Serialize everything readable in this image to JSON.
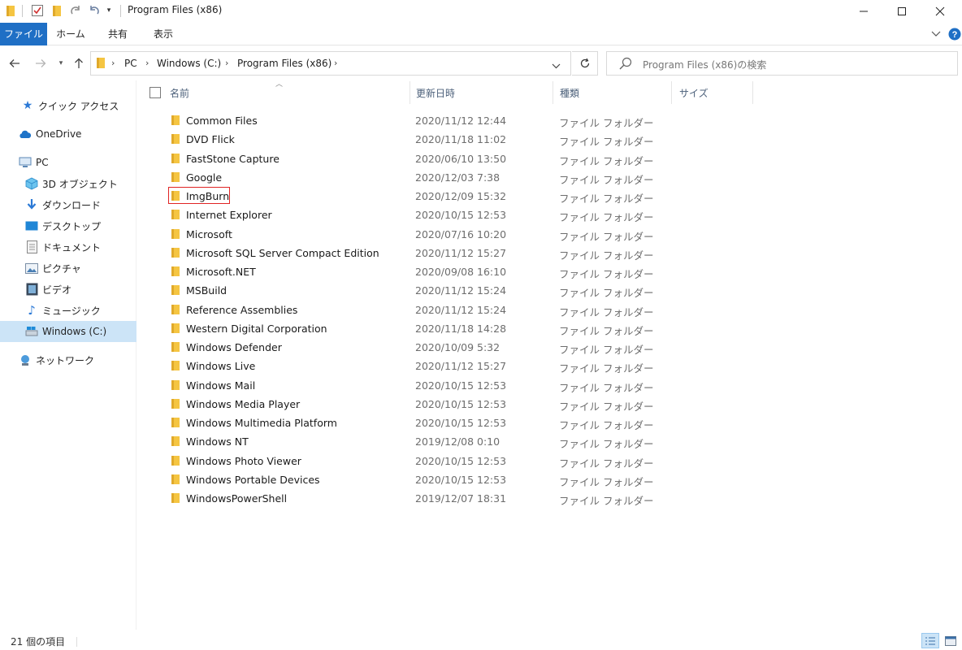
{
  "window": {
    "title": "Program Files (x86)"
  },
  "ribbon": {
    "tabs": [
      "ファイル",
      "ホーム",
      "共有",
      "表示"
    ]
  },
  "address": {
    "segments": [
      "PC",
      "Windows (C:)",
      "Program Files (x86)"
    ]
  },
  "search": {
    "placeholder": "Program Files (x86)の検索"
  },
  "nav_pane": {
    "quick_access": "クイック アクセス",
    "onedrive": "OneDrive",
    "pc": "PC",
    "items": [
      "3D オブジェクト",
      "ダウンロード",
      "デスクトップ",
      "ドキュメント",
      "ピクチャ",
      "ビデオ",
      "ミュージック",
      "Windows (C:)"
    ],
    "network": "ネットワーク",
    "selected": "Windows (C:)"
  },
  "columns": {
    "name": "名前",
    "date": "更新日時",
    "type": "種類",
    "size": "サイズ"
  },
  "files": [
    {
      "name": "Common Files",
      "date": "2020/11/12 12:44",
      "type": "ファイル フォルダー"
    },
    {
      "name": "DVD Flick",
      "date": "2020/11/18 11:02",
      "type": "ファイル フォルダー"
    },
    {
      "name": "FastStone Capture",
      "date": "2020/06/10 13:50",
      "type": "ファイル フォルダー"
    },
    {
      "name": "Google",
      "date": "2020/12/03 7:38",
      "type": "ファイル フォルダー"
    },
    {
      "name": "ImgBurn",
      "date": "2020/12/09 15:32",
      "type": "ファイル フォルダー",
      "highlighted": true
    },
    {
      "name": "Internet Explorer",
      "date": "2020/10/15 12:53",
      "type": "ファイル フォルダー"
    },
    {
      "name": "Microsoft",
      "date": "2020/07/16 10:20",
      "type": "ファイル フォルダー"
    },
    {
      "name": "Microsoft SQL Server Compact Edition",
      "date": "2020/11/12 15:27",
      "type": "ファイル フォルダー"
    },
    {
      "name": "Microsoft.NET",
      "date": "2020/09/08 16:10",
      "type": "ファイル フォルダー"
    },
    {
      "name": "MSBuild",
      "date": "2020/11/12 15:24",
      "type": "ファイル フォルダー"
    },
    {
      "name": "Reference Assemblies",
      "date": "2020/11/12 15:24",
      "type": "ファイル フォルダー"
    },
    {
      "name": "Western Digital Corporation",
      "date": "2020/11/18 14:28",
      "type": "ファイル フォルダー"
    },
    {
      "name": "Windows Defender",
      "date": "2020/10/09 5:32",
      "type": "ファイル フォルダー"
    },
    {
      "name": "Windows Live",
      "date": "2020/11/12 15:27",
      "type": "ファイル フォルダー"
    },
    {
      "name": "Windows Mail",
      "date": "2020/10/15 12:53",
      "type": "ファイル フォルダー"
    },
    {
      "name": "Windows Media Player",
      "date": "2020/10/15 12:53",
      "type": "ファイル フォルダー"
    },
    {
      "name": "Windows Multimedia Platform",
      "date": "2020/10/15 12:53",
      "type": "ファイル フォルダー"
    },
    {
      "name": "Windows NT",
      "date": "2019/12/08 0:10",
      "type": "ファイル フォルダー"
    },
    {
      "name": "Windows Photo Viewer",
      "date": "2020/10/15 12:53",
      "type": "ファイル フォルダー"
    },
    {
      "name": "Windows Portable Devices",
      "date": "2020/10/15 12:53",
      "type": "ファイル フォルダー"
    },
    {
      "name": "WindowsPowerShell",
      "date": "2019/12/07 18:31",
      "type": "ファイル フォルダー"
    }
  ],
  "status": {
    "count": "21 個の項目"
  },
  "colors": {
    "accent": "#1f6fc5",
    "folder": "#f5c542",
    "selection": "#cce4f7",
    "highlight_box": "#e02424"
  }
}
